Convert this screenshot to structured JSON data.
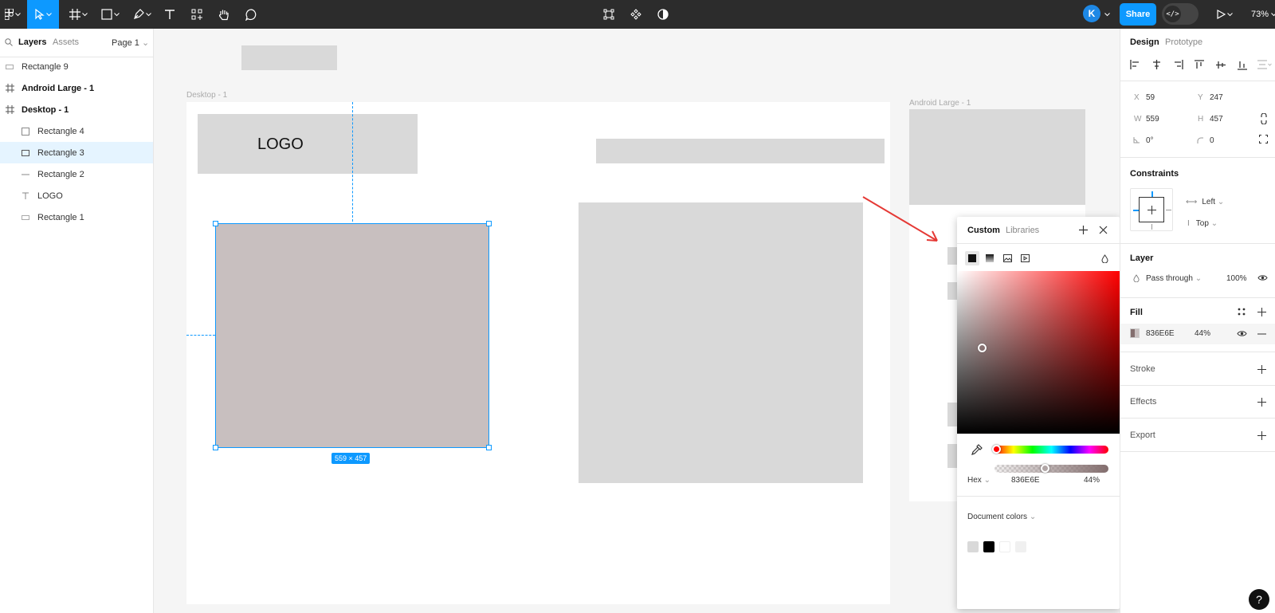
{
  "toolbar": {
    "avatar_initial": "K",
    "share_label": "Share",
    "dev_mode_label": "</>",
    "zoom": "73%"
  },
  "left_panel": {
    "tabs": [
      "Layers",
      "Assets"
    ],
    "page": "Page 1",
    "layers": [
      {
        "name": "Rectangle 9",
        "icon": "rectangle-icon"
      },
      {
        "name": "Android Large - 1",
        "icon": "frame-icon"
      },
      {
        "name": "Desktop - 1",
        "icon": "frame-icon"
      },
      {
        "name": "Rectangle 4",
        "icon": "rectangle-icon"
      },
      {
        "name": "Rectangle 3",
        "icon": "rectangle-icon",
        "selected": true
      },
      {
        "name": "Rectangle 2",
        "icon": "line-icon"
      },
      {
        "name": "LOGO",
        "icon": "text-icon"
      },
      {
        "name": "Rectangle 1",
        "icon": "rectangle-icon"
      }
    ]
  },
  "canvas": {
    "desktop_label": "Desktop - 1",
    "android_label": "Android Large - 1",
    "logo_text": "LOGO",
    "selection_dims": "559 × 457"
  },
  "color_picker": {
    "tabs": [
      "Custom",
      "Libraries"
    ],
    "format": "Hex",
    "hex": "836E6E",
    "opacity": "44%",
    "document_colors_label": "Document colors",
    "document_colors": [
      "#d9d9d9",
      "#000000",
      "#ffffff",
      "#f5f5f5"
    ]
  },
  "right_panel": {
    "tabs": [
      "Design",
      "Prototype"
    ],
    "x_label": "X",
    "x": "59",
    "y_label": "Y",
    "y": "247",
    "w_label": "W",
    "w": "559",
    "h_label": "H",
    "h": "457",
    "rotation": "0°",
    "radius": "0",
    "constraints_title": "Constraints",
    "constraint_h": "Left",
    "constraint_v": "Top",
    "layer_title": "Layer",
    "blend": "Pass through",
    "layer_opacity": "100%",
    "fill_title": "Fill",
    "fill_hex": "836E6E",
    "fill_opacity": "44%",
    "stroke_title": "Stroke",
    "effects_title": "Effects",
    "export_title": "Export"
  },
  "help_label": "?",
  "colors": {
    "accent": "#0d99ff",
    "toolbar_bg": "#2c2c2c",
    "fill": "#836E6E"
  }
}
